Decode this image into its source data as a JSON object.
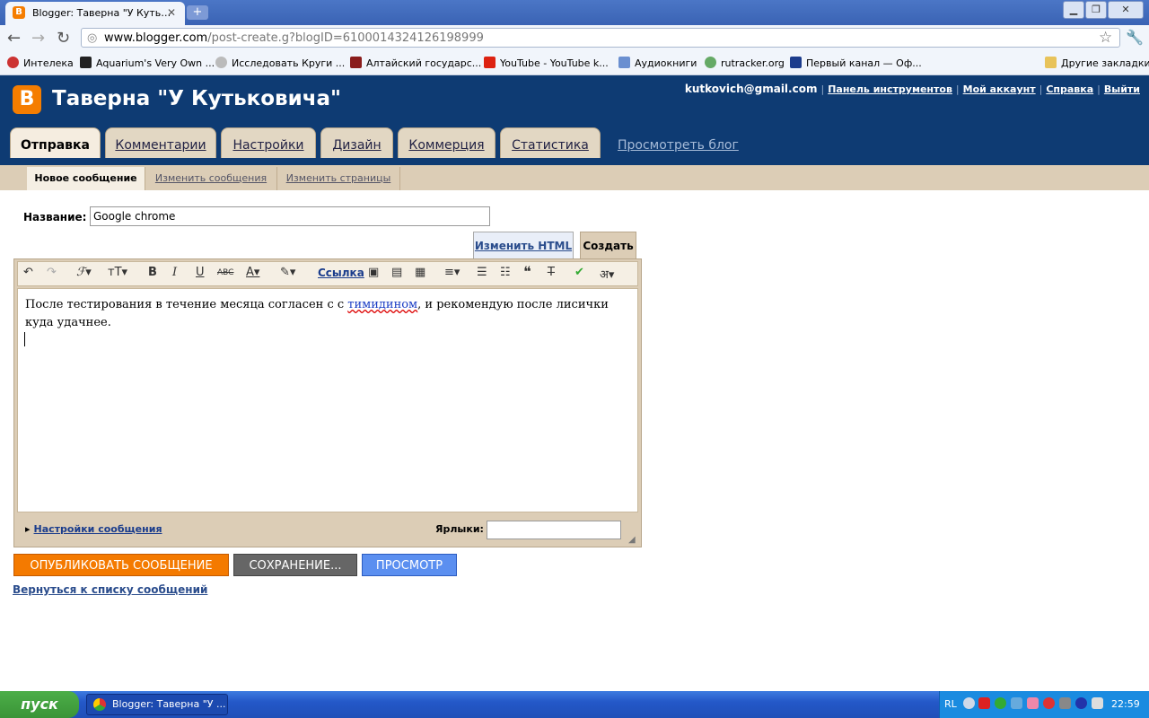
{
  "browser": {
    "tab_title": "Blogger: Таверна \"У Куть…",
    "url_host": "www.blogger.com",
    "url_path": "/post-create.g?blogID=6100014324126198999",
    "bookmarks": [
      "Интелека",
      "Aquarium's Very Own ...",
      "Исследовать Круги ...",
      "Алтайский государс...",
      "YouTube - YouTube k...",
      "Аудиокниги",
      "rutracker.org",
      "Первый канал — Оф..."
    ],
    "other_bookmarks": "Другие закладки"
  },
  "blogger": {
    "blog_title": "Таверна \"У Кутьковича\"",
    "account_email": "kutkovich@gmail.com",
    "account_links": [
      "Панель инструментов",
      "Мой аккаунт",
      "Справка",
      "Выйти"
    ],
    "tabs": [
      "Отправка",
      "Комментарии",
      "Настройки",
      "Дизайн",
      "Коммерция",
      "Статистика"
    ],
    "view_blog": "Просмотреть блог",
    "subtabs": [
      "Новое сообщение",
      "Изменить сообщения",
      "Изменить страницы"
    ]
  },
  "editor": {
    "title_label": "Название:",
    "title_value": "Google chrome",
    "edit_html": "Изменить HTML",
    "compose": "Создать",
    "link_label": "Ссылка",
    "body_before": "После тестирования в течение месяца согласен с с ",
    "body_misspelled": "тимидином",
    "body_after": ", и рекомендую после лисички куда удачнее.",
    "post_options": "Настройки сообщения",
    "labels_label": "Ярлыки:",
    "publish": "ОПУБЛИКОВАТЬ СООБЩЕНИЕ",
    "saving": "СОХРАНЕНИЕ...",
    "preview": "ПРОСМОТР",
    "back": "Вернуться к списку сообщений"
  },
  "taskbar": {
    "start": "пуск",
    "window": "Blogger: Таверна \"У ...",
    "lang": "RL",
    "time": "22:59"
  },
  "colors": {
    "blogger_header": "#0e3b73",
    "blogger_orange": "#f57d00",
    "publish_button": "#f47a00",
    "saving_button": "#666666",
    "preview_button": "#5b8ff0"
  }
}
